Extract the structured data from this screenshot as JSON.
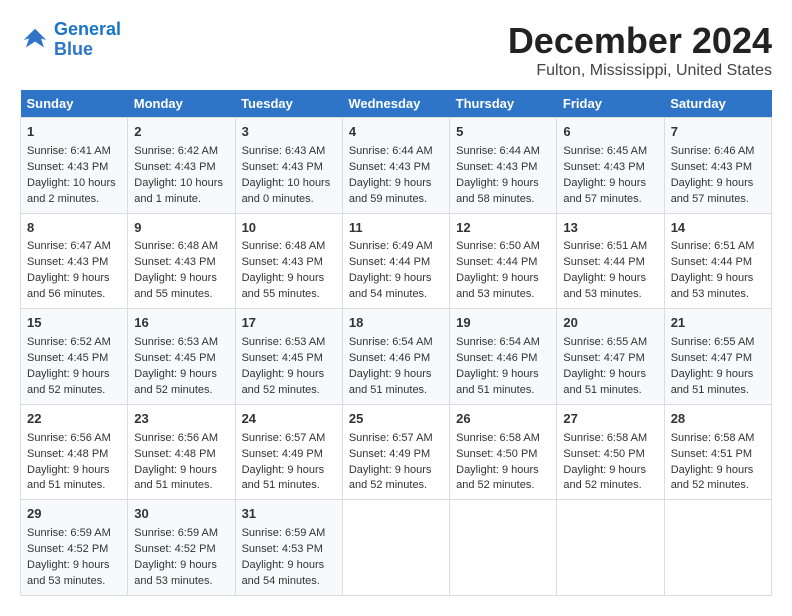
{
  "logo": {
    "line1": "General",
    "line2": "Blue"
  },
  "title": "December 2024",
  "location": "Fulton, Mississippi, United States",
  "days_of_week": [
    "Sunday",
    "Monday",
    "Tuesday",
    "Wednesday",
    "Thursday",
    "Friday",
    "Saturday"
  ],
  "weeks": [
    [
      {
        "day": "1",
        "sunrise": "6:41 AM",
        "sunset": "4:43 PM",
        "daylight": "10 hours and 2 minutes."
      },
      {
        "day": "2",
        "sunrise": "6:42 AM",
        "sunset": "4:43 PM",
        "daylight": "10 hours and 1 minute."
      },
      {
        "day": "3",
        "sunrise": "6:43 AM",
        "sunset": "4:43 PM",
        "daylight": "10 hours and 0 minutes."
      },
      {
        "day": "4",
        "sunrise": "6:44 AM",
        "sunset": "4:43 PM",
        "daylight": "9 hours and 59 minutes."
      },
      {
        "day": "5",
        "sunrise": "6:44 AM",
        "sunset": "4:43 PM",
        "daylight": "9 hours and 58 minutes."
      },
      {
        "day": "6",
        "sunrise": "6:45 AM",
        "sunset": "4:43 PM",
        "daylight": "9 hours and 57 minutes."
      },
      {
        "day": "7",
        "sunrise": "6:46 AM",
        "sunset": "4:43 PM",
        "daylight": "9 hours and 57 minutes."
      }
    ],
    [
      {
        "day": "8",
        "sunrise": "6:47 AM",
        "sunset": "4:43 PM",
        "daylight": "9 hours and 56 minutes."
      },
      {
        "day": "9",
        "sunrise": "6:48 AM",
        "sunset": "4:43 PM",
        "daylight": "9 hours and 55 minutes."
      },
      {
        "day": "10",
        "sunrise": "6:48 AM",
        "sunset": "4:43 PM",
        "daylight": "9 hours and 55 minutes."
      },
      {
        "day": "11",
        "sunrise": "6:49 AM",
        "sunset": "4:44 PM",
        "daylight": "9 hours and 54 minutes."
      },
      {
        "day": "12",
        "sunrise": "6:50 AM",
        "sunset": "4:44 PM",
        "daylight": "9 hours and 53 minutes."
      },
      {
        "day": "13",
        "sunrise": "6:51 AM",
        "sunset": "4:44 PM",
        "daylight": "9 hours and 53 minutes."
      },
      {
        "day": "14",
        "sunrise": "6:51 AM",
        "sunset": "4:44 PM",
        "daylight": "9 hours and 53 minutes."
      }
    ],
    [
      {
        "day": "15",
        "sunrise": "6:52 AM",
        "sunset": "4:45 PM",
        "daylight": "9 hours and 52 minutes."
      },
      {
        "day": "16",
        "sunrise": "6:53 AM",
        "sunset": "4:45 PM",
        "daylight": "9 hours and 52 minutes."
      },
      {
        "day": "17",
        "sunrise": "6:53 AM",
        "sunset": "4:45 PM",
        "daylight": "9 hours and 52 minutes."
      },
      {
        "day": "18",
        "sunrise": "6:54 AM",
        "sunset": "4:46 PM",
        "daylight": "9 hours and 51 minutes."
      },
      {
        "day": "19",
        "sunrise": "6:54 AM",
        "sunset": "4:46 PM",
        "daylight": "9 hours and 51 minutes."
      },
      {
        "day": "20",
        "sunrise": "6:55 AM",
        "sunset": "4:47 PM",
        "daylight": "9 hours and 51 minutes."
      },
      {
        "day": "21",
        "sunrise": "6:55 AM",
        "sunset": "4:47 PM",
        "daylight": "9 hours and 51 minutes."
      }
    ],
    [
      {
        "day": "22",
        "sunrise": "6:56 AM",
        "sunset": "4:48 PM",
        "daylight": "9 hours and 51 minutes."
      },
      {
        "day": "23",
        "sunrise": "6:56 AM",
        "sunset": "4:48 PM",
        "daylight": "9 hours and 51 minutes."
      },
      {
        "day": "24",
        "sunrise": "6:57 AM",
        "sunset": "4:49 PM",
        "daylight": "9 hours and 51 minutes."
      },
      {
        "day": "25",
        "sunrise": "6:57 AM",
        "sunset": "4:49 PM",
        "daylight": "9 hours and 52 minutes."
      },
      {
        "day": "26",
        "sunrise": "6:58 AM",
        "sunset": "4:50 PM",
        "daylight": "9 hours and 52 minutes."
      },
      {
        "day": "27",
        "sunrise": "6:58 AM",
        "sunset": "4:50 PM",
        "daylight": "9 hours and 52 minutes."
      },
      {
        "day": "28",
        "sunrise": "6:58 AM",
        "sunset": "4:51 PM",
        "daylight": "9 hours and 52 minutes."
      }
    ],
    [
      {
        "day": "29",
        "sunrise": "6:59 AM",
        "sunset": "4:52 PM",
        "daylight": "9 hours and 53 minutes."
      },
      {
        "day": "30",
        "sunrise": "6:59 AM",
        "sunset": "4:52 PM",
        "daylight": "9 hours and 53 minutes."
      },
      {
        "day": "31",
        "sunrise": "6:59 AM",
        "sunset": "4:53 PM",
        "daylight": "9 hours and 54 minutes."
      },
      null,
      null,
      null,
      null
    ]
  ]
}
